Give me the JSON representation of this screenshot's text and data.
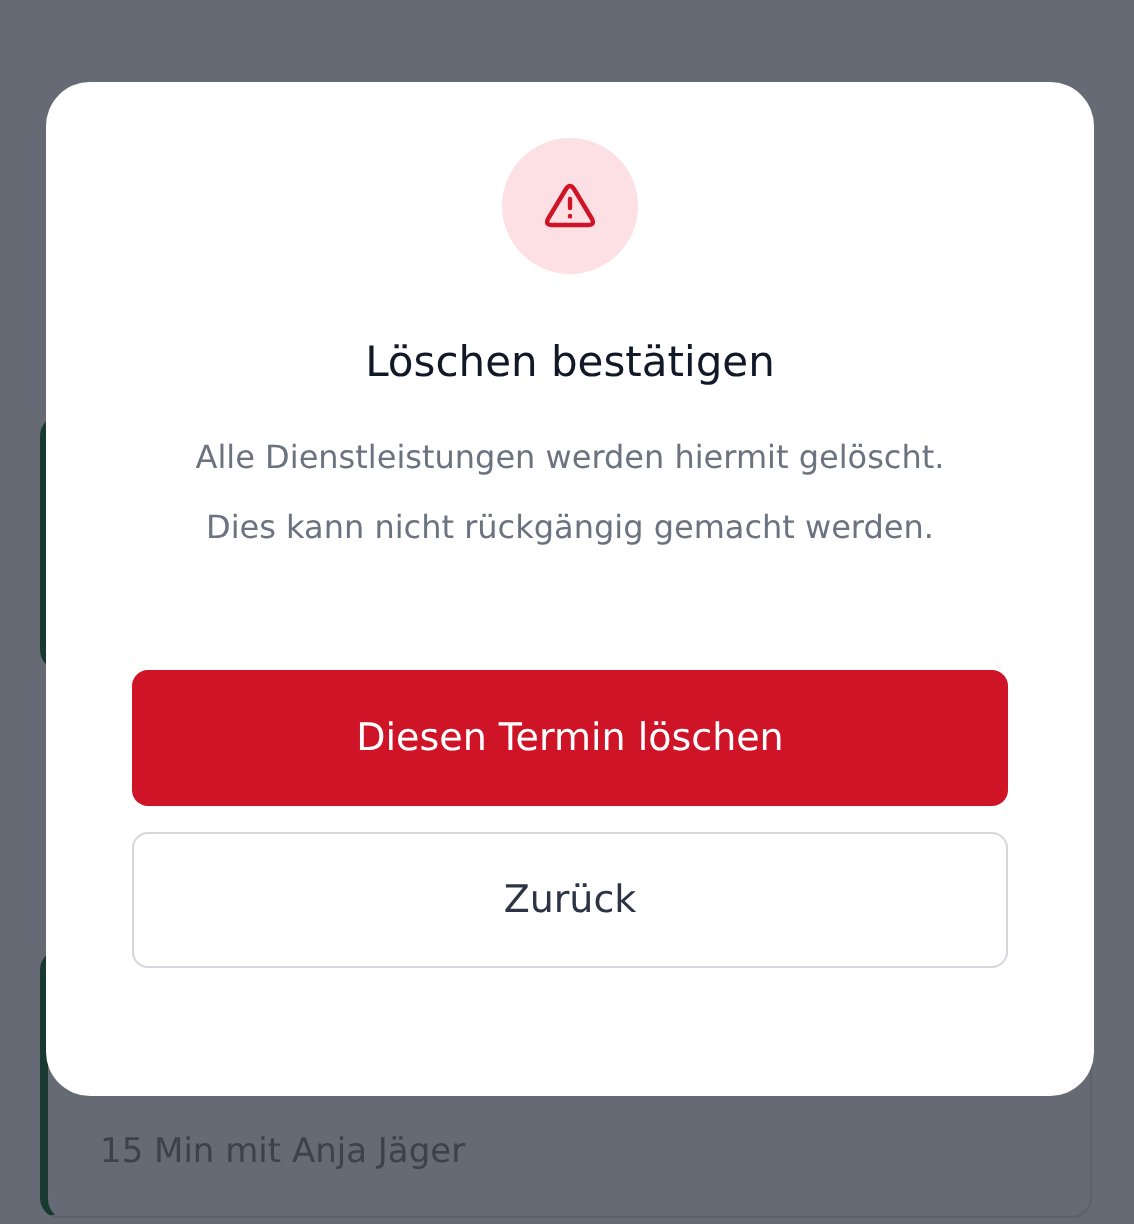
{
  "background": {
    "card_subtitle": "15 Min mit Anja Jäger"
  },
  "dialog": {
    "title": "Löschen bestätigen",
    "message_lines": [
      "Alle Dienstleistungen werden hiermit gelöscht.",
      "Dies kann nicht rückgängig gemacht werden."
    ],
    "buttons": [
      {
        "label": "Diesen Termin löschen",
        "kind": "danger"
      },
      {
        "label": "Zurück",
        "kind": "secondary"
      }
    ]
  }
}
